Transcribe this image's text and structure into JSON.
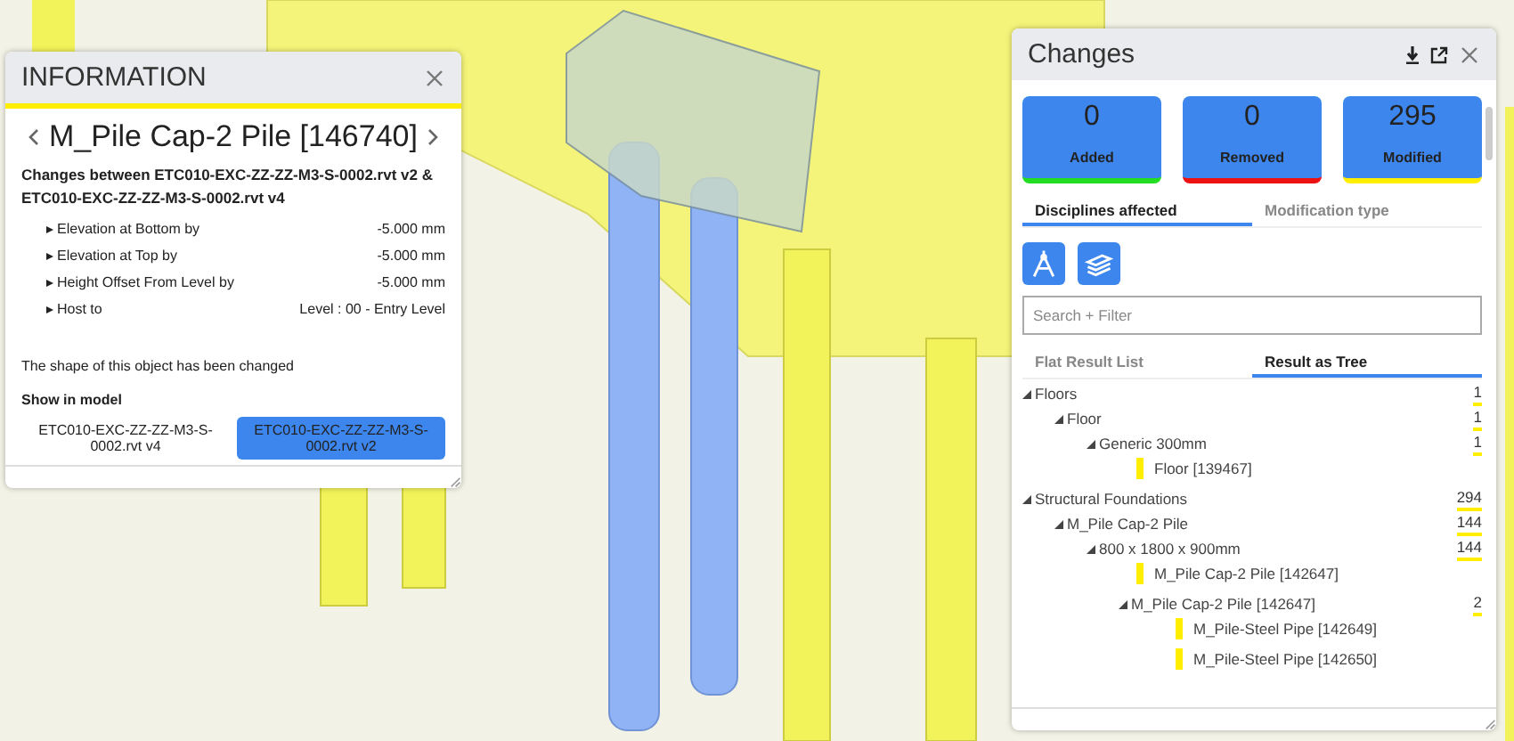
{
  "information": {
    "title": "INFORMATION",
    "object_name": "M_Pile Cap-2 Pile [146740]",
    "changes_heading": "Changes between ETC010-EXC-ZZ-ZZ-M3-S-0002.rvt v2 & ETC010-EXC-ZZ-ZZ-M3-S-0002.rvt v4",
    "properties": [
      {
        "label": "Elevation at Bottom by",
        "value": "-5.000 mm"
      },
      {
        "label": "Elevation at Top by",
        "value": "-5.000 mm"
      },
      {
        "label": "Height Offset From Level by",
        "value": "-5.000 mm"
      },
      {
        "label": "Host to",
        "value": "Level : 00 - Entry Level"
      }
    ],
    "shape_note": "The shape of this object has been changed",
    "show_in_model_label": "Show in model",
    "versions": [
      {
        "label": "ETC010-EXC-ZZ-ZZ-M3-S-0002.rvt v4",
        "selected": false
      },
      {
        "label": "ETC010-EXC-ZZ-ZZ-M3-S-0002.rvt v2",
        "selected": true
      }
    ]
  },
  "changes": {
    "title": "Changes",
    "stats": [
      {
        "count": "0",
        "label": "Added",
        "color": "#22dd22"
      },
      {
        "count": "0",
        "label": "Removed",
        "color": "#ee1111"
      },
      {
        "count": "295",
        "label": "Modified",
        "color": "#ffee00"
      }
    ],
    "view_tabs": [
      {
        "label": "Disciplines affected",
        "selected": true
      },
      {
        "label": "Modification type",
        "selected": false
      }
    ],
    "search": {
      "placeholder": "Search + Filter"
    },
    "result_tabs": [
      {
        "label": "Flat Result List",
        "selected": false
      },
      {
        "label": "Result as Tree",
        "selected": true
      }
    ],
    "tree": [
      {
        "kind": "group",
        "label": "Floors",
        "count": "1",
        "expanded": true,
        "children": [
          {
            "kind": "group",
            "label": "Floor",
            "count": "1",
            "expanded": true,
            "children": [
              {
                "kind": "group",
                "label": "Generic 300mm",
                "count": "1",
                "expanded": true,
                "children": [
                  {
                    "kind": "element",
                    "label": "Floor [139467]"
                  }
                ]
              }
            ]
          }
        ]
      },
      {
        "kind": "group",
        "label": "Structural Foundations",
        "count": "294",
        "expanded": true,
        "children": [
          {
            "kind": "group",
            "label": "M_Pile Cap-2 Pile",
            "count": "144",
            "expanded": true,
            "children": [
              {
                "kind": "group",
                "label": "800 x 1800 x 900mm",
                "count": "144",
                "expanded": true,
                "children": [
                  {
                    "kind": "element",
                    "label": "M_Pile Cap-2 Pile [142647]"
                  },
                  {
                    "kind": "group",
                    "label": "M_Pile Cap-2 Pile [142647]",
                    "count": "2",
                    "expanded": true,
                    "children": [
                      {
                        "kind": "element",
                        "label": "M_Pile-Steel Pipe [142649]"
                      },
                      {
                        "kind": "element",
                        "label": "M_Pile-Steel Pipe [142650]"
                      }
                    ]
                  }
                ]
              }
            ]
          }
        ]
      }
    ]
  }
}
